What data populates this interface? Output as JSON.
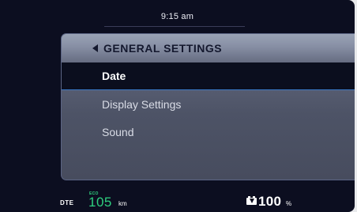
{
  "status_bar": {
    "time": "9:15 am"
  },
  "panel": {
    "title": "GENERAL SETTINGS",
    "back_icon": "back-arrow-icon",
    "items": [
      {
        "label": "Date",
        "selected": true
      },
      {
        "label": "Display Settings",
        "selected": false
      },
      {
        "label": "Sound",
        "selected": false
      }
    ]
  },
  "footer": {
    "dte_label": "DTE",
    "mode": "ECO",
    "range_value": "105",
    "range_unit": "km",
    "battery_icon": "battery-charging-icon",
    "battery_value": "100",
    "battery_unit": "%"
  },
  "colors": {
    "background": "#0c0e20",
    "accent_green": "#2ecf7f",
    "selection_outline": "#3a78c6"
  }
}
